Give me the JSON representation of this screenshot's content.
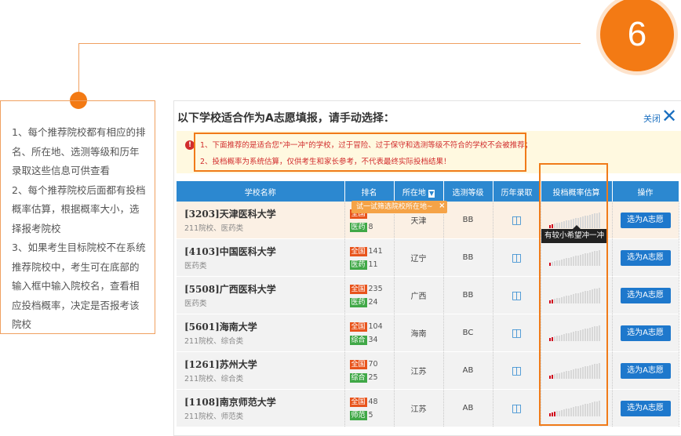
{
  "badge": "6",
  "explain": [
    "1、每个推荐院校都有相应的排名、所在地、选测等级和历年录取这些信息可供查看",
    "2、每个推荐院校后面都有投档概率估算，根据概率大小，选择报考院校",
    "3、如果考生目标院校不在系统推荐院校中，考生可在底部的输入框中输入院校名，查看相应投档概率，决定是否报考该院校"
  ],
  "panel": {
    "title": "以下学校适合作为A志愿填报，请手动选择：",
    "close_label": "关闭",
    "close_icon": "✕",
    "notice1": "1、下面推荐的是适合您\"冲一冲\"的学校，过于冒险、过于保守和选测等级不符合的学校不会被推荐；",
    "notice2": "2、投档概率为系统估算，仅供考生和家长参考，不代表最终实际投档结果！",
    "warn_icon": "!"
  },
  "table": {
    "headers": {
      "school": "学校名称",
      "rank": "排名",
      "location": "所在地",
      "level": "选测等级",
      "history": "历年录取",
      "probability": "投档概率估算",
      "action": "操作"
    },
    "rows": [
      {
        "name": "[3203]天津医科大学",
        "tags": "211院校、医药类",
        "all_label": "全国",
        "all_rank": "",
        "cat_label": "医药",
        "cat_rank": "8",
        "location": "天津",
        "level": "BB",
        "prob": 0.2,
        "action": "选为A志愿"
      },
      {
        "name": "[4103]中国医科大学",
        "tags": "医药类",
        "all_label": "全国",
        "all_rank": "141",
        "cat_label": "医药",
        "cat_rank": "11",
        "location": "辽宁",
        "level": "BB",
        "prob": 0.1,
        "action": "选为A志愿"
      },
      {
        "name": "[5508]广西医科大学",
        "tags": "医药类",
        "all_label": "全国",
        "all_rank": "235",
        "cat_label": "医药",
        "cat_rank": "24",
        "location": "广西",
        "level": "BB",
        "prob": 0.2,
        "action": "选为A志愿"
      },
      {
        "name": "[5601]海南大学",
        "tags": "211院校、综合类",
        "all_label": "全国",
        "all_rank": "104",
        "cat_label": "综合",
        "cat_rank": "34",
        "location": "海南",
        "level": "BC",
        "prob": 0.2,
        "action": "选为A志愿"
      },
      {
        "name": "[1261]苏州大学",
        "tags": "211院校、综合类",
        "all_label": "全国",
        "all_rank": "70",
        "cat_label": "综合",
        "cat_rank": "25",
        "location": "江苏",
        "level": "AB",
        "prob": 0.2,
        "action": "选为A志愿"
      },
      {
        "name": "[1108]南京师范大学",
        "tags": "211院校、师范类",
        "all_label": "全国",
        "all_rank": "48",
        "cat_label": "师范",
        "cat_rank": "5",
        "location": "江苏",
        "level": "AB",
        "prob": 0.3,
        "action": "选为A志愿"
      }
    ]
  },
  "tooltip_filter": "试一试筛选院校所在地~",
  "tooltip_filter_close": "×",
  "tooltip_prob": "有较小希望冲一冲",
  "colors": {
    "accent": "#f37a14",
    "header": "#2c88d0",
    "button": "#1e78cc",
    "bar_on": "#d0021b"
  }
}
